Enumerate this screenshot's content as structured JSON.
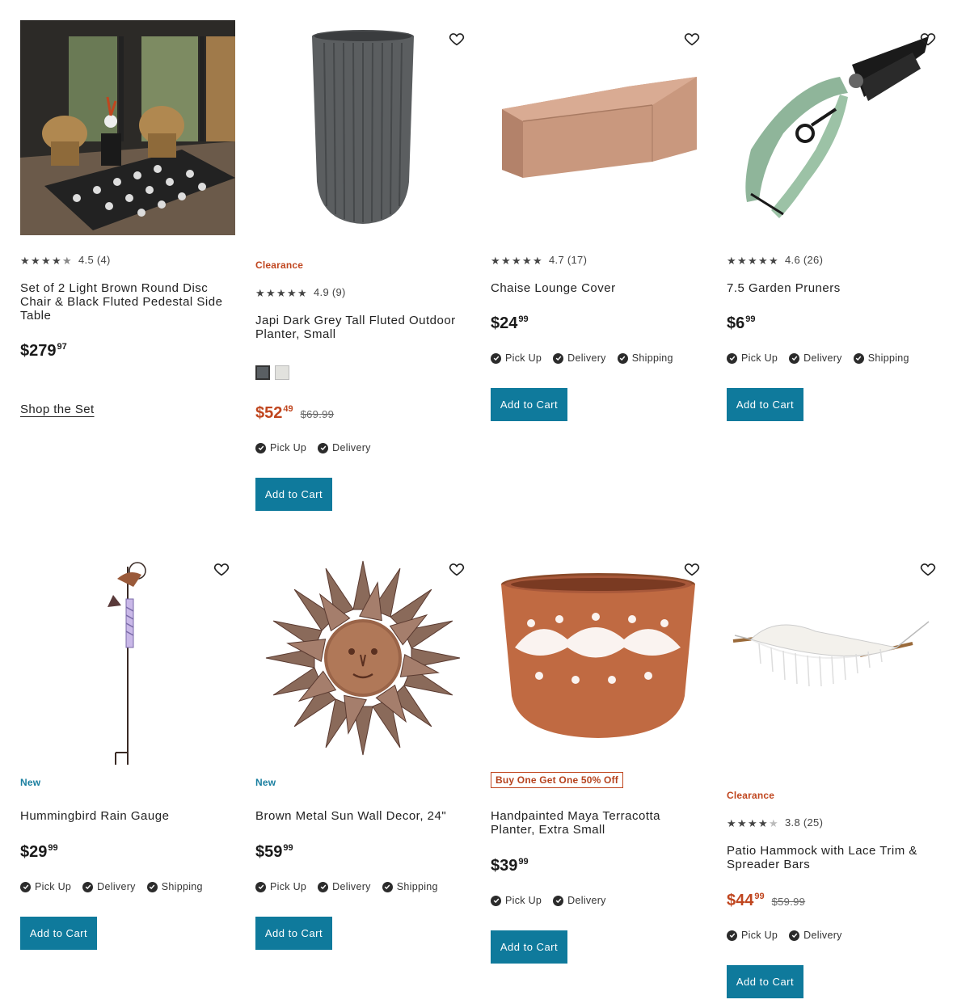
{
  "products": [
    {
      "title": "Set of 2 Light Brown Round Disc Chair & Black Fluted Pedestal Side Table",
      "rating": "4.5 (4)",
      "price_dollars": "$279",
      "price_cents": "97",
      "link_label": "Shop the Set"
    },
    {
      "badge": "Clearance",
      "rating": "4.9 (9)",
      "title": "Japi Dark Grey Tall Fluted Outdoor Planter, Small",
      "swatches": [
        "#5a5f63",
        "#e2e2de"
      ],
      "price_dollars": "$52",
      "price_cents": "49",
      "was_price": "$69.99",
      "fulfillment": [
        "Pick Up",
        "Delivery"
      ],
      "button": "Add to Cart"
    },
    {
      "rating": "4.7 (17)",
      "title": "Chaise Lounge Cover",
      "price_dollars": "$24",
      "price_cents": "99",
      "fulfillment": [
        "Pick Up",
        "Delivery",
        "Shipping"
      ],
      "button": "Add to Cart"
    },
    {
      "rating": "4.6 (26)",
      "title": "7.5 Garden Pruners",
      "price_dollars": "$6",
      "price_cents": "99",
      "fulfillment": [
        "Pick Up",
        "Delivery",
        "Shipping"
      ],
      "button": "Add to Cart"
    },
    {
      "badge": "New",
      "title": "Hummingbird Rain Gauge",
      "price_dollars": "$29",
      "price_cents": "99",
      "fulfillment": [
        "Pick Up",
        "Delivery",
        "Shipping"
      ],
      "button": "Add to Cart"
    },
    {
      "badge": "New",
      "title": "Brown Metal Sun Wall Decor, 24\"",
      "price_dollars": "$59",
      "price_cents": "99",
      "fulfillment": [
        "Pick Up",
        "Delivery",
        "Shipping"
      ],
      "button": "Add to Cart"
    },
    {
      "badge": "Buy One Get One 50% Off",
      "title": "Handpainted Maya Terracotta Planter, Extra Small",
      "price_dollars": "$39",
      "price_cents": "99",
      "fulfillment": [
        "Pick Up",
        "Delivery"
      ],
      "button": "Add to Cart"
    },
    {
      "badge": "Clearance",
      "rating": "3.8 (25)",
      "title": "Patio Hammock with Lace Trim & Spreader Bars",
      "price_dollars": "$44",
      "price_cents": "99",
      "was_price": "$59.99",
      "fulfillment": [
        "Pick Up",
        "Delivery"
      ],
      "button": "Add to Cart"
    }
  ],
  "colors": {
    "accent_button": "#0f7a9c",
    "clearance": "#c0461f",
    "new": "#1a7fa0"
  }
}
